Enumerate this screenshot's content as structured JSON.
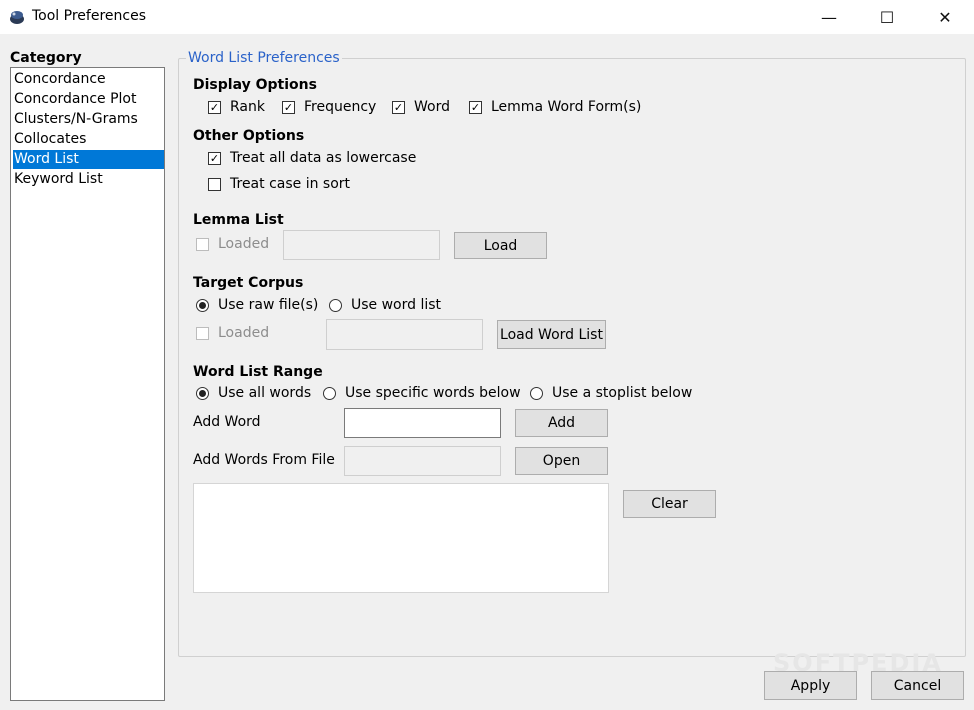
{
  "window": {
    "title": "Tool Preferences",
    "minimize": "—",
    "maximize": "☐",
    "close": "✕"
  },
  "category": {
    "label": "Category",
    "items": [
      "Concordance",
      "Concordance Plot",
      "Clusters/N-Grams",
      "Collocates",
      "Word List",
      "Keyword List"
    ],
    "selected": "Word List"
  },
  "prefs": {
    "group_title": "Word List Preferences",
    "display_options": {
      "heading": "Display Options",
      "rank": "Rank",
      "frequency": "Frequency",
      "word": "Word",
      "lemma": "Lemma Word Form(s)"
    },
    "other_options": {
      "heading": "Other Options",
      "lowercase": "Treat all data as lowercase",
      "case_sort": "Treat case in sort"
    },
    "lemma_list": {
      "heading": "Lemma List",
      "loaded": "Loaded",
      "load_button": "Load"
    },
    "target_corpus": {
      "heading": "Target Corpus",
      "raw": "Use raw file(s)",
      "wordlist": "Use word list",
      "loaded": "Loaded",
      "load_button": "Load Word List"
    },
    "range": {
      "heading": "Word List Range",
      "all": "Use all words",
      "specific": "Use specific words below",
      "stoplist": "Use a stoplist below",
      "add_word_label": "Add Word",
      "add_button": "Add",
      "add_file_label": "Add Words From File",
      "open_button": "Open",
      "clear_button": "Clear"
    }
  },
  "footer": {
    "apply": "Apply",
    "cancel": "Cancel"
  },
  "watermark": "SOFTPEDIA"
}
